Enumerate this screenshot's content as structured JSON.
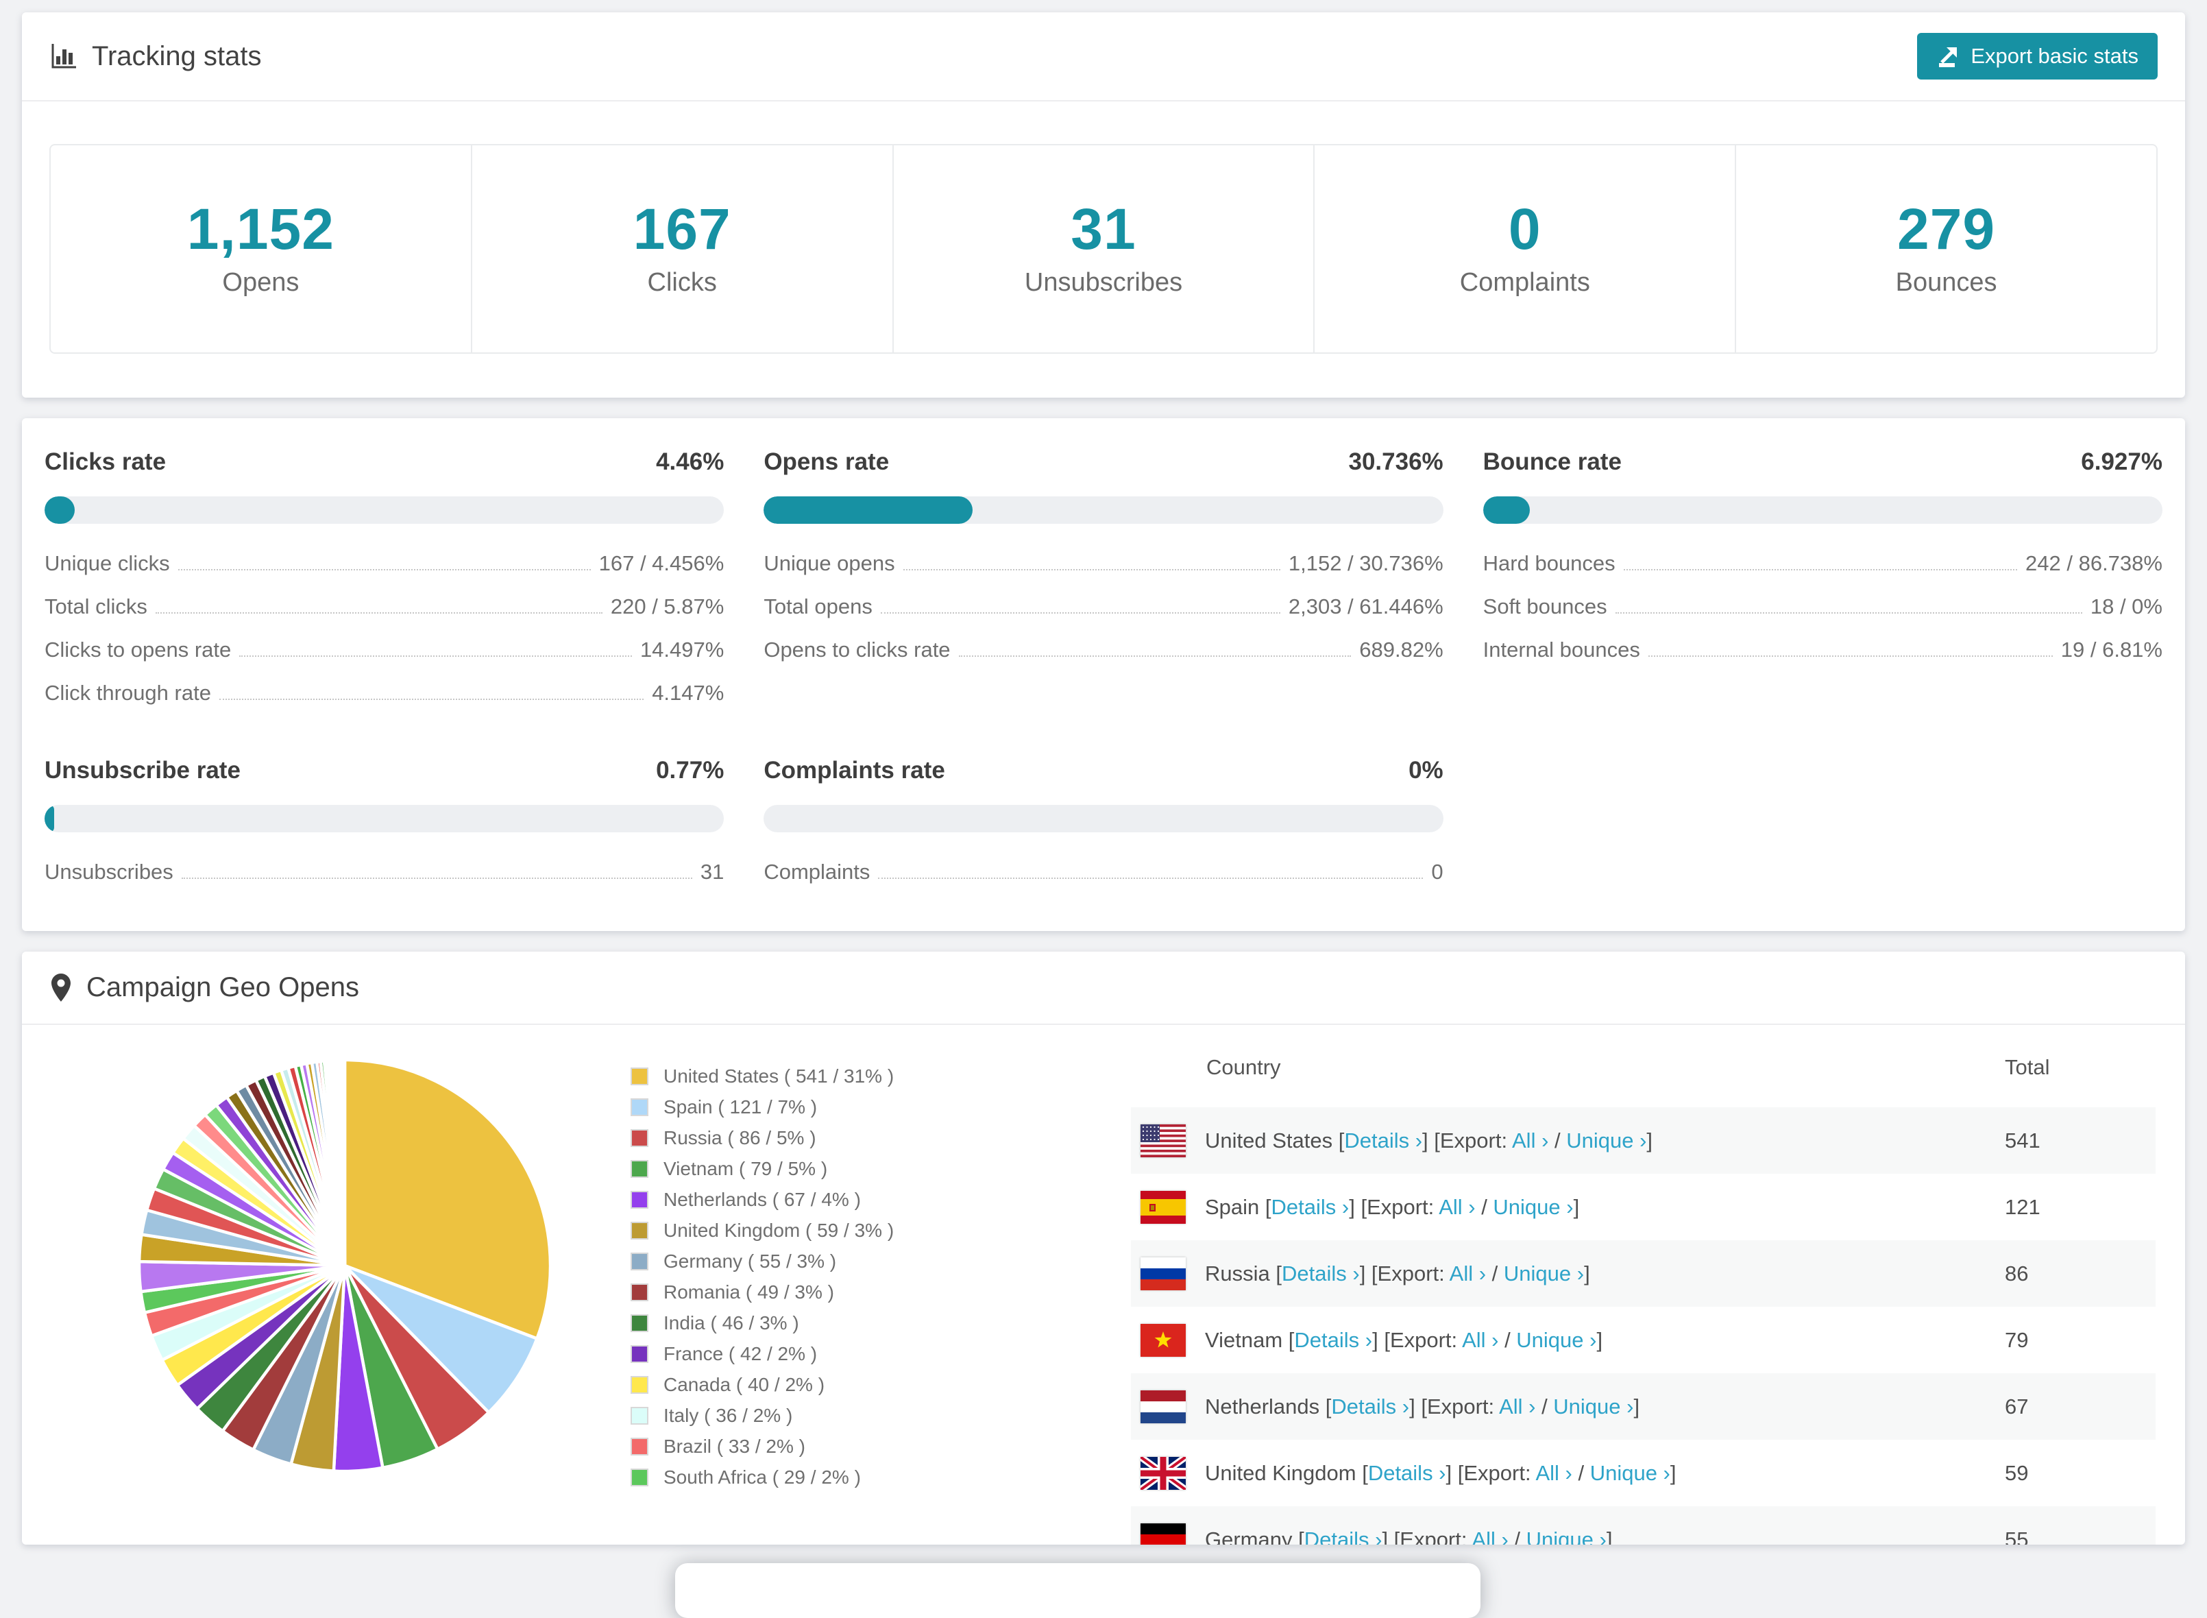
{
  "header": {
    "title": "Tracking stats",
    "export_button": "Export basic stats"
  },
  "summary": [
    {
      "value": "1,152",
      "label": "Opens"
    },
    {
      "value": "167",
      "label": "Clicks"
    },
    {
      "value": "31",
      "label": "Unsubscribes"
    },
    {
      "value": "0",
      "label": "Complaints"
    },
    {
      "value": "279",
      "label": "Bounces"
    }
  ],
  "rates": {
    "clicks": {
      "title": "Clicks rate",
      "value": "4.46%",
      "percent": 4.46,
      "rows": [
        {
          "label": "Unique clicks",
          "value": "167 / 4.456%"
        },
        {
          "label": "Total clicks",
          "value": "220 / 5.87%"
        },
        {
          "label": "Clicks to opens rate",
          "value": "14.497%"
        },
        {
          "label": "Click through rate",
          "value": "4.147%"
        }
      ]
    },
    "opens": {
      "title": "Opens rate",
      "value": "30.736%",
      "percent": 30.736,
      "rows": [
        {
          "label": "Unique opens",
          "value": "1,152 / 30.736%"
        },
        {
          "label": "Total opens",
          "value": "2,303 / 61.446%"
        },
        {
          "label": "Opens to clicks rate",
          "value": "689.82%"
        }
      ]
    },
    "bounce": {
      "title": "Bounce rate",
      "value": "6.927%",
      "percent": 6.927,
      "rows": [
        {
          "label": "Hard bounces",
          "value": "242 / 86.738%"
        },
        {
          "label": "Soft bounces",
          "value": "18 / 0%"
        },
        {
          "label": "Internal bounces",
          "value": "19 / 6.81%"
        }
      ]
    },
    "unsubscribe": {
      "title": "Unsubscribe rate",
      "value": "0.77%",
      "percent": 0.77,
      "rows": [
        {
          "label": "Unsubscribes",
          "value": "31"
        }
      ]
    },
    "complaints": {
      "title": "Complaints rate",
      "value": "0%",
      "percent": 0,
      "rows": [
        {
          "label": "Complaints",
          "value": "0"
        }
      ]
    }
  },
  "geo": {
    "title": "Campaign Geo Opens",
    "table_headers": {
      "country": "Country",
      "total": "Total"
    },
    "link_labels": {
      "details": "Details ›",
      "export_prefix": "Export:",
      "all": "All ›",
      "unique": "Unique ›",
      "bracket_open": "[",
      "bracket_close": "]",
      "slash": "/"
    }
  },
  "chart_data": {
    "type": "pie",
    "title": "Campaign Geo Opens",
    "legend_position": "right",
    "series": [
      {
        "name": "United States",
        "value": 541,
        "percent": 31,
        "color": "#EDC240",
        "flag": "us",
        "in_table": true
      },
      {
        "name": "Spain",
        "value": 121,
        "percent": 7,
        "color": "#AFD8F8",
        "flag": "es",
        "in_table": true
      },
      {
        "name": "Russia",
        "value": 86,
        "percent": 5,
        "color": "#CB4B4B",
        "flag": "ru",
        "in_table": true
      },
      {
        "name": "Vietnam",
        "value": 79,
        "percent": 5,
        "color": "#4DA74D",
        "flag": "vn",
        "in_table": true
      },
      {
        "name": "Netherlands",
        "value": 67,
        "percent": 4,
        "color": "#9440ED",
        "flag": "nl",
        "in_table": true
      },
      {
        "name": "United Kingdom",
        "value": 59,
        "percent": 3,
        "color": "#BD9B33",
        "flag": "gb",
        "in_table": true
      },
      {
        "name": "Germany",
        "value": 55,
        "percent": 3,
        "color": "#8CACC6",
        "flag": "de",
        "in_table": true
      },
      {
        "name": "Romania",
        "value": 49,
        "percent": 3,
        "color": "#A23C3C",
        "flag": "ro",
        "in_table": false
      },
      {
        "name": "India",
        "value": 46,
        "percent": 3,
        "color": "#3E863E",
        "flag": "in",
        "in_table": false
      },
      {
        "name": "France",
        "value": 42,
        "percent": 2,
        "color": "#7633BE",
        "flag": "fr",
        "in_table": false
      },
      {
        "name": "Canada",
        "value": 40,
        "percent": 2,
        "color": "#FFE84D",
        "flag": "ca",
        "in_table": false
      },
      {
        "name": "Italy",
        "value": 36,
        "percent": 2,
        "color": "#DBFDF9",
        "flag": "it",
        "in_table": false
      },
      {
        "name": "Brazil",
        "value": 33,
        "percent": 2,
        "color": "#F36A6A",
        "flag": "br",
        "in_table": false
      },
      {
        "name": "South Africa",
        "value": 29,
        "percent": 2,
        "color": "#5CC85C",
        "flag": "za",
        "in_table": false
      }
    ],
    "legend_label_format": "{name} ( {value} / {percent}% )",
    "others_values": [
      41,
      37,
      34,
      31,
      29,
      26,
      24,
      23,
      21,
      20,
      18,
      16,
      15,
      15,
      13,
      13,
      11,
      10,
      10,
      8,
      8,
      7,
      7,
      5,
      5,
      4,
      3,
      3,
      3,
      2,
      2,
      2,
      2,
      1,
      1,
      1,
      1,
      1,
      1,
      1
    ],
    "others_colors": [
      "#B878F0",
      "#C9A227",
      "#9FC3DE",
      "#E05555",
      "#66BE66",
      "#A55FF0",
      "#FFF066",
      "#EAFDFB",
      "#FF8B8B",
      "#7CD87C",
      "#8F44D6",
      "#8A7119",
      "#6E8BA3",
      "#7E2D2D",
      "#2F6B2F",
      "#4A1E80",
      "#E8E84D",
      "#C7ECEC",
      "#D94444",
      "#45B045"
    ]
  }
}
